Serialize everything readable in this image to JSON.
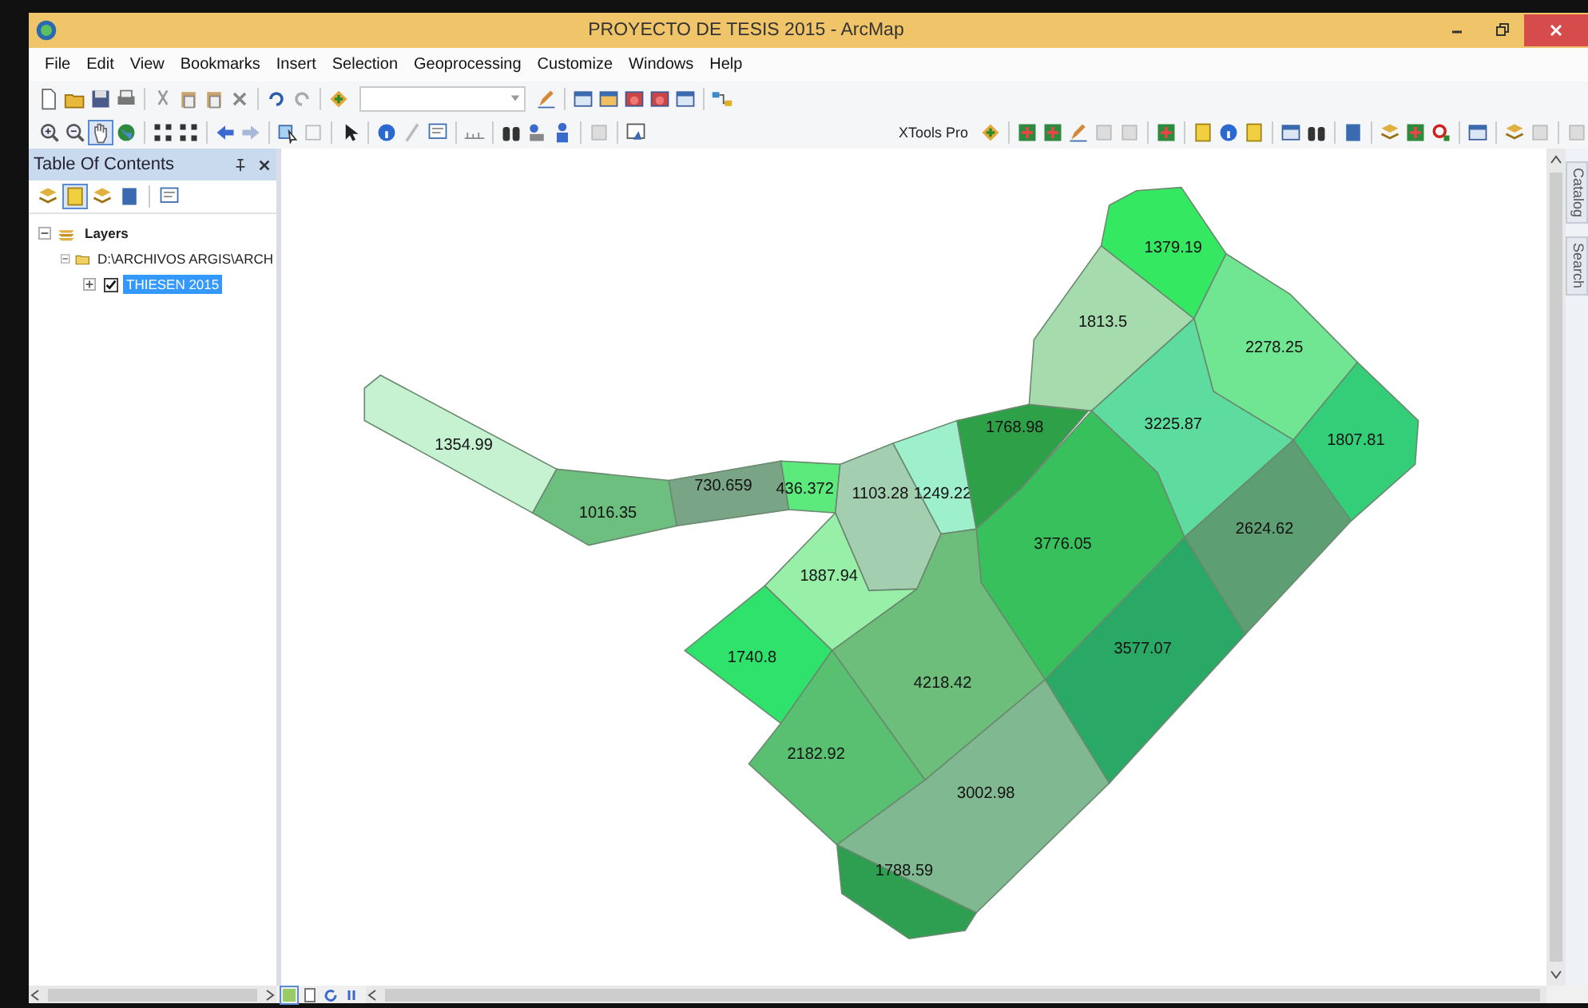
{
  "window": {
    "title": "PROYECTO DE TESIS 2015 - ArcMap"
  },
  "menu": [
    "File",
    "Edit",
    "View",
    "Bookmarks",
    "Insert",
    "Selection",
    "Geoprocessing",
    "Customize",
    "Windows",
    "Help"
  ],
  "toolbar": {
    "dropdown": "XTools Pro"
  },
  "toc": {
    "title": "Table Of Contents",
    "tree": [
      {
        "label": "Layers",
        "expanded": true,
        "children": [
          {
            "label": "D:\\ARCHIVOS ARGIS\\ARCH",
            "expanded": true,
            "children": [
              {
                "label": "THIESEN 2015",
                "expanded": false,
                "checked": true,
                "selected": true
              }
            ]
          }
        ]
      }
    ]
  },
  "map": {
    "polygons": [
      {
        "label": "1354.99",
        "color": "#c6f2d2"
      },
      {
        "label": "1016.35",
        "color": "#6cbf7e"
      },
      {
        "label": "730.659",
        "color": "#7aa486"
      },
      {
        "label": "436.372",
        "color": "#5cea7c"
      },
      {
        "label": "1103.28",
        "color": "#a4ceb0"
      },
      {
        "label": "1249.22",
        "color": "#9eefcb"
      },
      {
        "label": "1768.98",
        "color": "#2ea047"
      },
      {
        "label": "1813.5",
        "color": "#a6dcad"
      },
      {
        "label": "1379.19",
        "color": "#35e862"
      },
      {
        "label": "2278.25",
        "color": "#70e692"
      },
      {
        "label": "3225.87",
        "color": "#5edb9e"
      },
      {
        "label": "1807.81",
        "color": "#34cd78"
      },
      {
        "label": "2624.62",
        "color": "#5d9e72"
      },
      {
        "label": "3776.05",
        "color": "#38c05c"
      },
      {
        "label": "3577.07",
        "color": "#2aa866"
      },
      {
        "label": "1887.94",
        "color": "#98f0a8"
      },
      {
        "label": "4218.42",
        "color": "#6cbe7a"
      },
      {
        "label": "1740.8",
        "color": "#2ee26c"
      },
      {
        "label": "2182.92",
        "color": "#58c070"
      },
      {
        "label": "3002.98",
        "color": "#80b892"
      },
      {
        "label": "1788.59",
        "color": "#2e9e50"
      }
    ]
  },
  "side_tabs": [
    "Catalog",
    "Search"
  ]
}
